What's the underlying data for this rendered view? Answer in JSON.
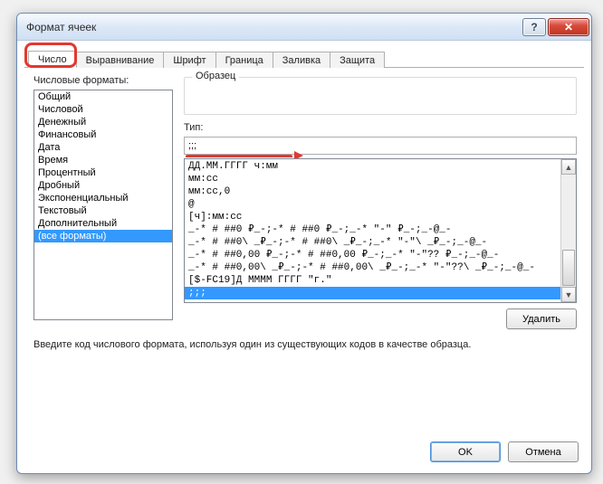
{
  "window": {
    "title": "Формат ячеек",
    "help": "?",
    "close": "✕"
  },
  "tabs": {
    "items": [
      {
        "label": "Число",
        "active": true
      },
      {
        "label": "Выравнивание"
      },
      {
        "label": "Шрифт"
      },
      {
        "label": "Граница"
      },
      {
        "label": "Заливка"
      },
      {
        "label": "Защита"
      }
    ]
  },
  "panel": {
    "categories_label": "Числовые форматы:",
    "categories": [
      "Общий",
      "Числовой",
      "Денежный",
      "Финансовый",
      "Дата",
      "Время",
      "Процентный",
      "Дробный",
      "Экспоненциальный",
      "Текстовый",
      "Дополнительный",
      "(все форматы)"
    ],
    "selected_category_index": 11,
    "sample_label": "Образец",
    "type_label": "Тип:",
    "type_value": ";;;",
    "formats": [
      "ДД.ММ.ГГГГ ч:мм",
      "мм:сс",
      "мм:сс,0",
      "@",
      "[ч]:мм:сс",
      "_-* # ##0 ₽_-;-* # ##0 ₽_-;_-* \"-\" ₽_-;_-@_-",
      "_-* # ##0\\ _₽_-;-* # ##0\\ _₽_-;_-* \"-\"\\ _₽_-;_-@_-",
      "_-* # ##0,00 ₽_-;-* # ##0,00 ₽_-;_-* \"-\"?? ₽_-;_-@_-",
      "_-* # ##0,00\\ _₽_-;-* # ##0,00\\ _₽_-;_-* \"-\"??\\ _₽_-;_-@_-",
      "[$-FC19]Д ММММ ГГГГ \"г.\"",
      ";;;"
    ],
    "selected_format_index": 10,
    "delete_label": "Удалить",
    "help_text": "Введите код числового формата, используя один из существующих кодов в качестве образца."
  },
  "buttons": {
    "ok": "OK",
    "cancel": "Отмена"
  }
}
